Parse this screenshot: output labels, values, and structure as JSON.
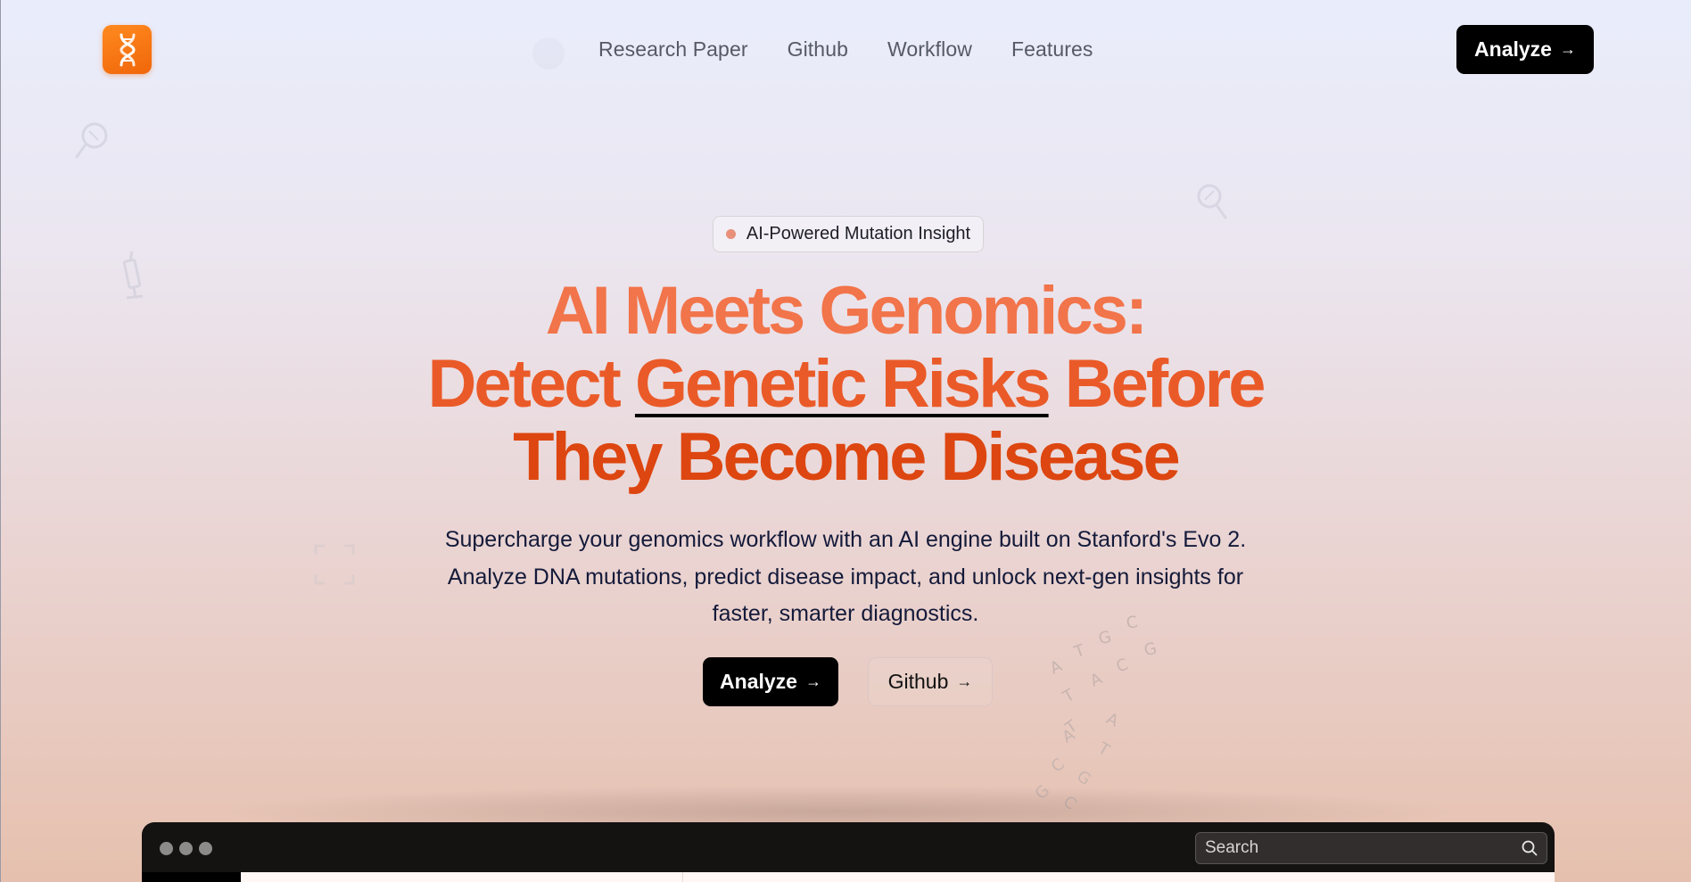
{
  "nav": {
    "logo_icon": "dna-icon",
    "links": [
      "Research Paper",
      "Github",
      "Workflow",
      "Features"
    ],
    "analyze_label": "Analyze",
    "analyze_arrow": "→"
  },
  "hero": {
    "badge_text": "AI-Powered Mutation Insight",
    "headline": {
      "line1": "AI Meets Genomics:",
      "line2_pre": "Detect ",
      "line2_underlined": "Genetic Risks",
      "line2_post": " Before",
      "line3": "They Become Disease"
    },
    "subtitle": "Supercharge your genomics workflow with an AI engine built on Stanford's Evo 2. Analyze DNA mutations, predict disease impact, and unlock next-gen insights for faster, smarter diagnostics.",
    "primary_cta": "Analyze",
    "secondary_cta": "Github",
    "cta_arrow": "→"
  },
  "dna_letters": [
    "A",
    "T",
    "G",
    "C",
    "T",
    "A",
    "C",
    "G",
    "T",
    "A",
    "A",
    "T",
    "C",
    "G",
    "G",
    "C"
  ],
  "app_window": {
    "search_placeholder": "Search"
  },
  "colors": {
    "accent": "#f0660a",
    "headline_top": "#f2744a",
    "headline_bottom": "#dd4610",
    "button_dark": "#000000",
    "window_bar": "#151212"
  },
  "icons": {
    "decorations": [
      "pin-icon",
      "pin-icon",
      "syringe-icon",
      "focus-frame-icon",
      "dna-icon"
    ],
    "search": "search-icon"
  }
}
